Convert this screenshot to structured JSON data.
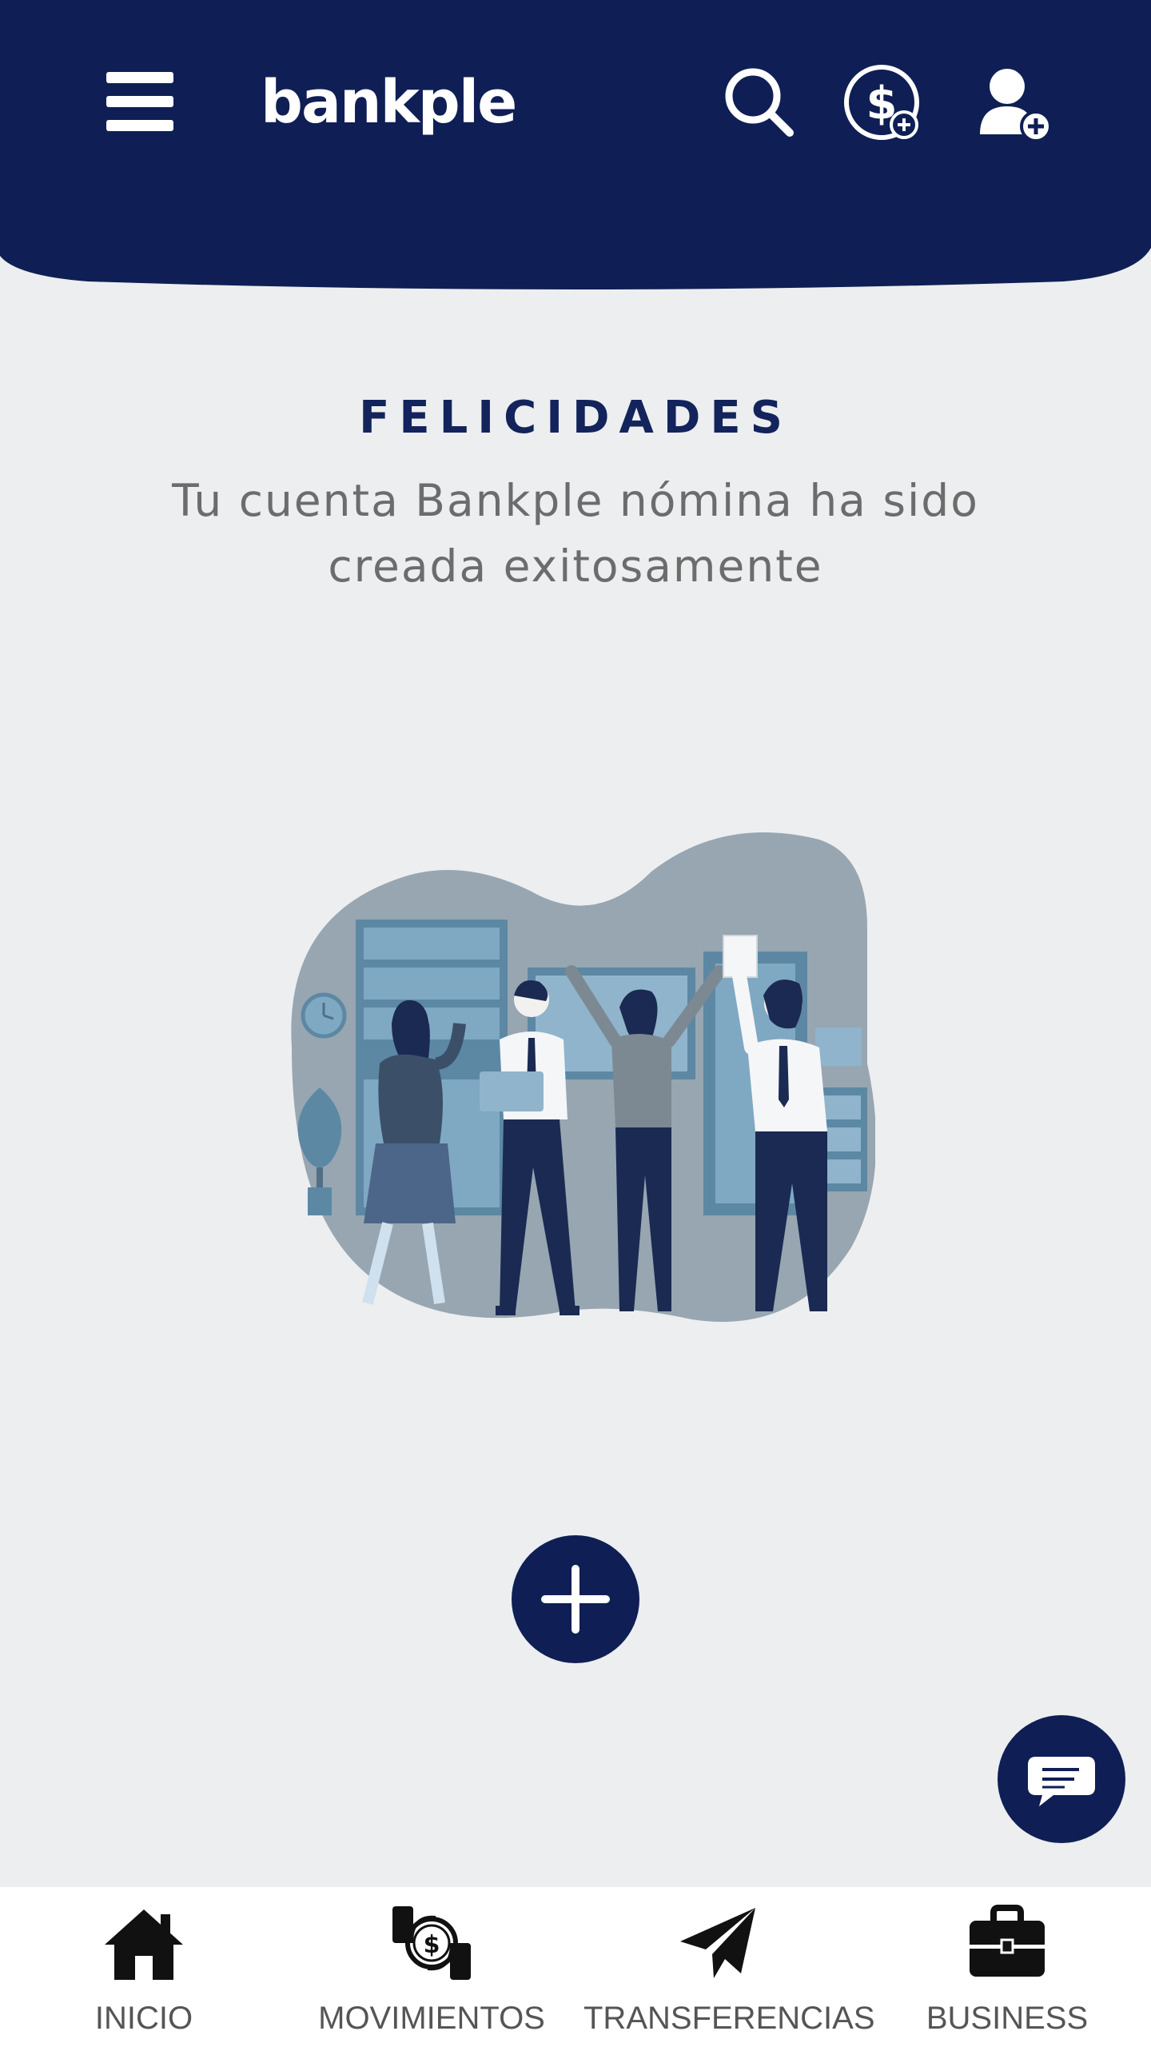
{
  "header": {
    "logo_text": "bankple",
    "icons": [
      "menu-icon",
      "search-icon",
      "add-money-icon",
      "add-user-icon"
    ],
    "background_color": "#0f1f55"
  },
  "main": {
    "title": "FELICIDADES",
    "subtitle": "Tu cuenta Bankple nómina ha sido creada exitosamente",
    "add_button_icon": "plus-icon",
    "chat_button_icon": "chat-icon"
  },
  "bottom_nav": {
    "items": [
      {
        "label": "INICIO",
        "icon": "home-icon"
      },
      {
        "label": "MOVIMIENTOS",
        "icon": "movements-icon"
      },
      {
        "label": "TRANSFERENCIAS",
        "icon": "paper-plane-icon"
      },
      {
        "label": "BUSINESS",
        "icon": "briefcase-icon"
      }
    ]
  },
  "colors": {
    "primary": "#0f1f55",
    "background": "#eceef0",
    "title": "#13235b",
    "subtitle": "#6c6c6c"
  }
}
